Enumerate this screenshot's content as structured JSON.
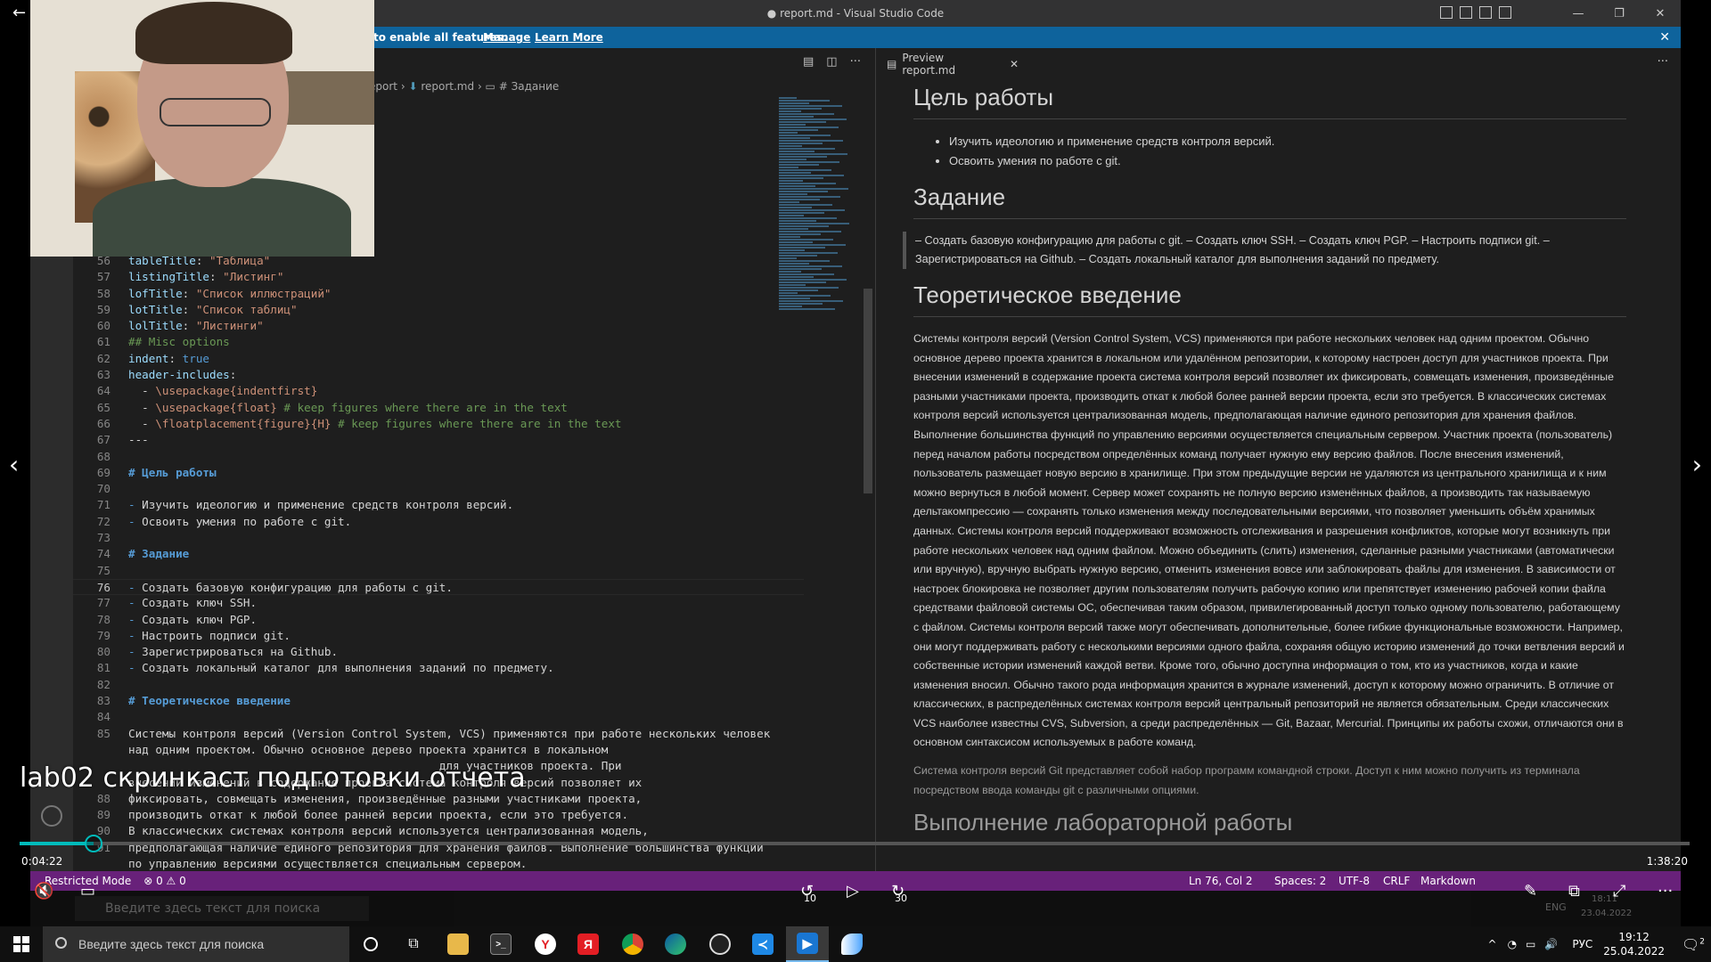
{
  "window": {
    "title": "● report.md - Visual Studio Code"
  },
  "notification": {
    "text": "to enable all features.",
    "manage": "Manage",
    "learn_more": "Learn More"
  },
  "breadcrumb": {
    "folder": "eport",
    "file": "report.md",
    "section": "# Задание"
  },
  "editor": {
    "lines": [
      {
        "n": "56",
        "parts": [
          [
            "k",
            "tableTitle"
          ],
          [
            "t",
            ": "
          ],
          [
            "s",
            "\"Таблица\""
          ]
        ]
      },
      {
        "n": "57",
        "parts": [
          [
            "k",
            "listingTitle"
          ],
          [
            "t",
            ": "
          ],
          [
            "s",
            "\"Листинг\""
          ]
        ]
      },
      {
        "n": "58",
        "parts": [
          [
            "k",
            "lofTitle"
          ],
          [
            "t",
            ": "
          ],
          [
            "s",
            "\"Список иллюстраций\""
          ]
        ]
      },
      {
        "n": "59",
        "parts": [
          [
            "k",
            "lotTitle"
          ],
          [
            "t",
            ": "
          ],
          [
            "s",
            "\"Список таблиц\""
          ]
        ]
      },
      {
        "n": "60",
        "parts": [
          [
            "k",
            "lolTitle"
          ],
          [
            "t",
            ": "
          ],
          [
            "s",
            "\"Листинги\""
          ]
        ]
      },
      {
        "n": "61",
        "parts": [
          [
            "c",
            "## Misc options"
          ]
        ]
      },
      {
        "n": "62",
        "parts": [
          [
            "k",
            "indent"
          ],
          [
            "t",
            ": "
          ],
          [
            "b",
            "true"
          ]
        ]
      },
      {
        "n": "63",
        "parts": [
          [
            "k",
            "header-includes"
          ],
          [
            "t",
            ":"
          ]
        ]
      },
      {
        "n": "64",
        "parts": [
          [
            "t",
            "  - "
          ],
          [
            "s",
            "\\usepackage{indentfirst}"
          ]
        ]
      },
      {
        "n": "65",
        "parts": [
          [
            "t",
            "  - "
          ],
          [
            "s",
            "\\usepackage{float}"
          ],
          [
            "c",
            " # keep figures where there are in the text"
          ]
        ]
      },
      {
        "n": "66",
        "parts": [
          [
            "t",
            "  - "
          ],
          [
            "s",
            "\\floatplacement{figure}{H}"
          ],
          [
            "c",
            " # keep figures where there are in the text"
          ]
        ]
      },
      {
        "n": "67",
        "parts": [
          [
            "t",
            "---"
          ]
        ]
      },
      {
        "n": "68",
        "parts": [
          [
            "t",
            ""
          ]
        ]
      },
      {
        "n": "69",
        "parts": [
          [
            "h",
            "# Цель работы"
          ]
        ]
      },
      {
        "n": "70",
        "parts": [
          [
            "t",
            ""
          ]
        ]
      },
      {
        "n": "71",
        "parts": [
          [
            "b",
            "- "
          ],
          [
            "t",
            "Изучить идеологию и применение средств контроля версий."
          ]
        ]
      },
      {
        "n": "72",
        "parts": [
          [
            "b",
            "- "
          ],
          [
            "t",
            "Освоить умения по работе с git."
          ]
        ]
      },
      {
        "n": "73",
        "parts": [
          [
            "t",
            ""
          ]
        ]
      },
      {
        "n": "74",
        "parts": [
          [
            "h",
            "# Задание"
          ]
        ]
      },
      {
        "n": "75",
        "parts": [
          [
            "t",
            ""
          ]
        ]
      },
      {
        "n": "76",
        "parts": [
          [
            "b",
            "- "
          ],
          [
            "t",
            "Создать базовую конфигурацию для работы с git."
          ]
        ],
        "current": true
      },
      {
        "n": "77",
        "parts": [
          [
            "b",
            "- "
          ],
          [
            "t",
            "Создать ключ SSH."
          ]
        ]
      },
      {
        "n": "78",
        "parts": [
          [
            "b",
            "- "
          ],
          [
            "t",
            "Создать ключ PGP."
          ]
        ]
      },
      {
        "n": "79",
        "parts": [
          [
            "b",
            "- "
          ],
          [
            "t",
            "Настроить подписи git."
          ]
        ]
      },
      {
        "n": "80",
        "parts": [
          [
            "b",
            "- "
          ],
          [
            "t",
            "Зарегистрироваться на Github."
          ]
        ]
      },
      {
        "n": "81",
        "parts": [
          [
            "b",
            "- "
          ],
          [
            "t",
            "Создать локальный каталог для выполнения заданий по предмету."
          ]
        ]
      },
      {
        "n": "82",
        "parts": [
          [
            "t",
            ""
          ]
        ]
      },
      {
        "n": "83",
        "parts": [
          [
            "h",
            "# Теоретическое введение"
          ]
        ]
      },
      {
        "n": "84",
        "parts": [
          [
            "t",
            ""
          ]
        ]
      },
      {
        "n": "85",
        "parts": [
          [
            "t",
            "Системы контроля версий (Version Control System, VCS) применяются при работе нескольких человек"
          ]
        ]
      },
      {
        "n": "",
        "parts": [
          [
            "t",
            "над одним проектом. Обычно основное дерево проекта хранится в локальном"
          ]
        ]
      },
      {
        "n": "",
        "parts": [
          [
            "t",
            "                                              для участников проекта. При"
          ]
        ]
      },
      {
        "n": "",
        "parts": [
          [
            "t",
            "внесении изменений в содержание проекта система контроля версий позволяет их"
          ]
        ]
      },
      {
        "n": "88",
        "parts": [
          [
            "t",
            "фиксировать, совмещать изменения, произведённые разными участниками проекта,"
          ]
        ]
      },
      {
        "n": "89",
        "parts": [
          [
            "t",
            "производить откат к любой более ранней версии проекта, если это требуется."
          ]
        ]
      },
      {
        "n": "90",
        "parts": [
          [
            "t",
            "В классических системах контроля версий используется централизованная модель,"
          ]
        ]
      },
      {
        "n": "91",
        "parts": [
          [
            "t",
            "предполагающая наличие единого репозитория для хранения файлов. Выполнение большинства функций"
          ]
        ]
      },
      {
        "n": "",
        "parts": [
          [
            "t",
            "по управлению версиями осуществляется специальным сервером."
          ]
        ]
      }
    ]
  },
  "preview": {
    "tab": "Preview report.md",
    "h_goal": "Цель работы",
    "goal_items": [
      "Изучить идеологию и применение средств контроля версий.",
      "Освоить умения по работе с git."
    ],
    "h_task": "Задание",
    "task_quote": "– Создать базовую конфигурацию для работы с git. – Создать ключ SSH. – Создать ключ PGP. – Настроить подписи git. – Зарегистрироваться на Github. – Создать локальный каталог для выполнения заданий по предмету.",
    "h_theory": "Теоретическое введение",
    "theory_p1": "Системы контроля версий (Version Control System, VCS) применяются при работе нескольких человек над одним проектом. Обычно основное дерево проекта хранится в локальном или удалённом репозитории, к которому настроен доступ для участников проекта. При внесении изменений в содержание проекта система контроля версий позволяет их фиксировать, совмещать изменения, произведённые разными участниками проекта, производить откат к любой более ранней версии проекта, если это требуется. В классических системах контроля версий используется централизованная модель, предполагающая наличие единого репозитория для хранения файлов. Выполнение большинства функций по управлению версиями осуществляется специальным сервером. Участник проекта (пользователь) перед началом работы посредством определённых команд получает нужную ему версию файлов. После внесения изменений, пользователь размещает новую версию в хранилище. При этом предыдущие версии не удаляются из центрального хранилища и к ним можно вернуться в любой момент. Сервер может сохранять не полную версию изменённых файлов, а производить так называемую дельтакомпрессию — сохранять только изменения между последовательными версиями, что позволяет уменьшить объём хранимых данных. Системы контроля версий поддерживают возможность отслеживания и разрешения конфликтов, которые могут возникнуть при работе нескольких человек над одним файлом. Можно объединить (слить) изменения, сделанные разными участниками (автоматически или вручную), вручную выбрать нужную версию, отменить изменения вовсе или заблокировать файлы для изменения. В зависимости от настроек блокировка не позволяет другим пользователям получить рабочую копию или препятствует изменению рабочей копии файла средствами файловой системы ОС, обеспечивая таким образом, привилегированный доступ только одному пользователю, работающему с файлом. Системы контроля версий также могут обеспечивать дополнительные, более гибкие функциональные возможности. Например, они могут поддерживать работу с несколькими версиями одного файла, сохраняя общую историю изменений до точки ветвления версий и собственные истории изменений каждой ветви. Кроме того, обычно доступна информация о том, кто из участников, когда и какие изменения вносил. Обычно такого рода информация хранится в журнале изменений, доступ к которому можно ограничить. В отличие от классических, в распределённых системах контроля версий центральный репозиторий не является обязательным. Среди классических VCS наиболее известны CVS, Subversion, а среди распределённых — Git, Bazaar, Mercurial. Принципы их работы схожи, отличаются они в основном синтаксисом используемых в работе команд.",
    "theory_p2": "Система контроля версий Git представляет собой набор программ командной строки. Доступ к ним можно получить из терминала посредством ввода команды git с различными опциями.",
    "h_exec": "Выполнение лабораторной работы"
  },
  "statusbar": {
    "left": "Restricted Mode",
    "problems": "⊗ 0 ⚠ 0",
    "position": "Ln 76, Col 2",
    "spaces": "Spaces: 2",
    "encoding": "UTF-8",
    "eol": "CRLF",
    "lang": "Markdown"
  },
  "video": {
    "caption": "lab02 скринкаст подготовки отчета",
    "time_current": "0:04:22",
    "time_total": "1:38:20",
    "progress": 0.0445,
    "skip_back": "10",
    "skip_fwd": "30"
  },
  "inner_taskbar": {
    "search_placeholder": "Введите здесь текст для поиска",
    "lang": "ENG",
    "time": "18:11",
    "date": "23.04.2022"
  },
  "taskbar": {
    "search_placeholder": "Введите здесь текст для поиска",
    "lang": "РУС",
    "time": "19:12",
    "date": "25.04.2022",
    "notif_count": "2"
  }
}
